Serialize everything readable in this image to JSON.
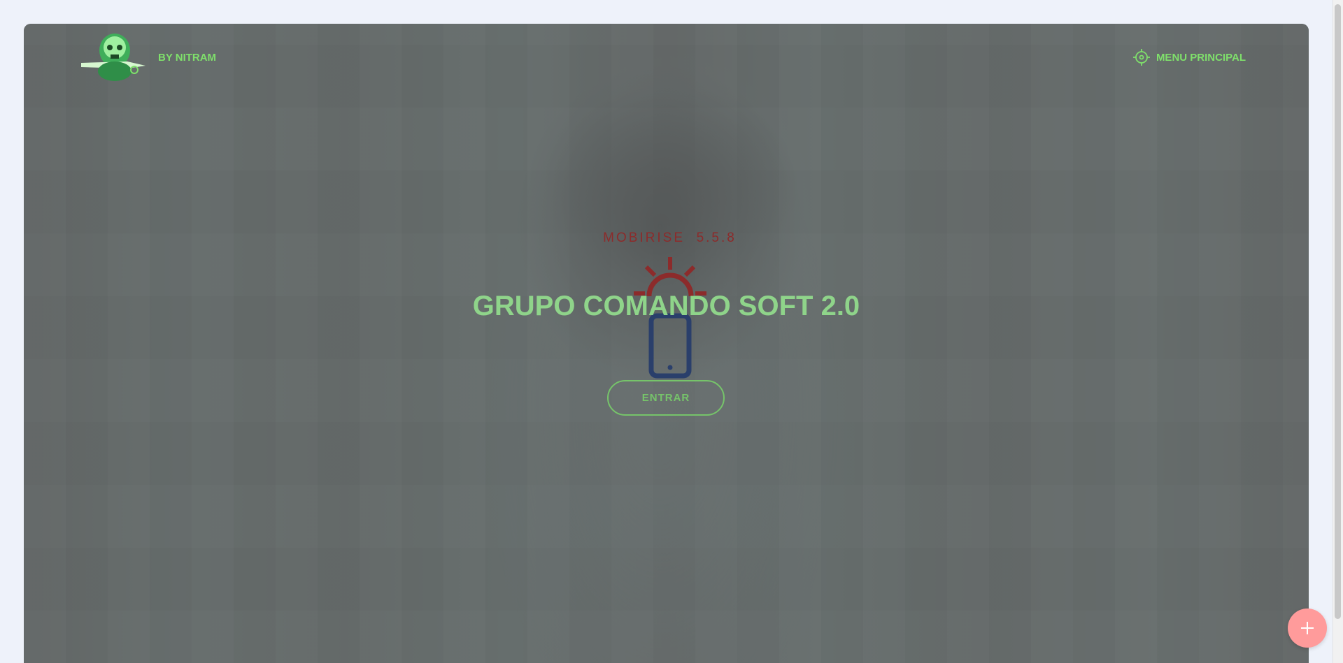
{
  "navbar": {
    "brand": "BY NITRAM",
    "logo_icon": "skull-sword-logo",
    "menu_label": "MENU PRINCIPAL",
    "menu_icon": "crosshair-icon"
  },
  "hero": {
    "subtitle": "MOBIRISE  5.5.8",
    "title": "GRUPO COMANDO SOFT 2.0",
    "enter_label": "ENTRAR",
    "overlay_icons": [
      "sun-icon",
      "phone-icon"
    ]
  },
  "fab": {
    "icon": "plus-icon"
  },
  "colors": {
    "accent_green": "#7fe06b",
    "title_green": "#8fd48a",
    "subtitle_red": "#8c2b2b",
    "fab_pink": "#ff9b9b",
    "phone_blue": "#2a3f6b"
  }
}
